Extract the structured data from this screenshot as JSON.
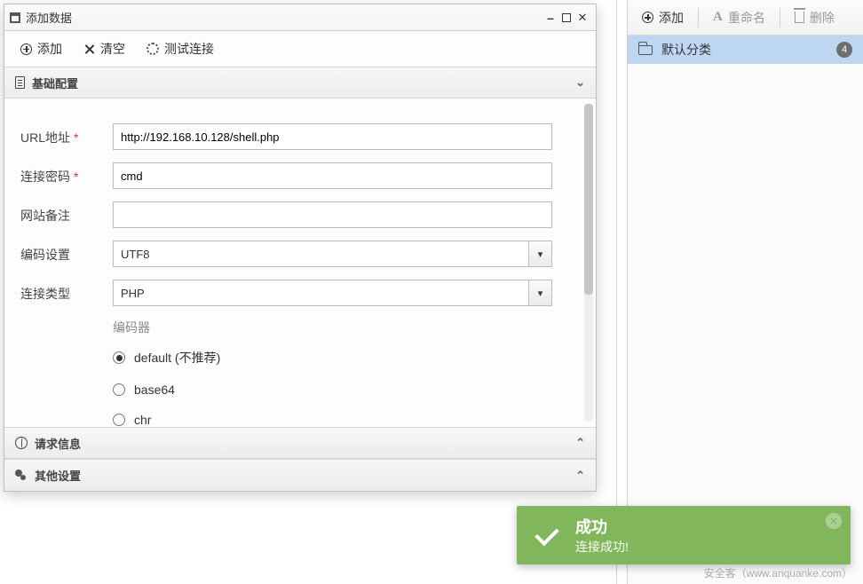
{
  "dialog": {
    "title": "添加数据",
    "toolbar": {
      "add": "添加",
      "clear": "清空",
      "test": "测试连接"
    }
  },
  "sections": {
    "basic": {
      "title": "基础配置"
    },
    "request": {
      "title": "请求信息"
    },
    "other": {
      "title": "其他设置"
    }
  },
  "form": {
    "url": {
      "label": "URL地址",
      "value": "http://192.168.10.128/shell.php"
    },
    "password": {
      "label": "连接密码",
      "value": "cmd"
    },
    "note": {
      "label": "网站备注",
      "value": ""
    },
    "encoding": {
      "label": "编码设置",
      "value": "UTF8"
    },
    "conntype": {
      "label": "连接类型",
      "value": "PHP"
    }
  },
  "encoder": {
    "title": "编码器",
    "options": {
      "default": "default (不推荐)",
      "base64": "base64",
      "chr": "chr"
    },
    "selected": "default"
  },
  "rightbar": {
    "add": "添加",
    "rename": "重命名",
    "delete": "删除",
    "category": {
      "name": "默认分类",
      "count": "4"
    }
  },
  "toast": {
    "title": "成功",
    "message": "连接成功!"
  },
  "watermark": "安全客（www.anquanke.com）"
}
